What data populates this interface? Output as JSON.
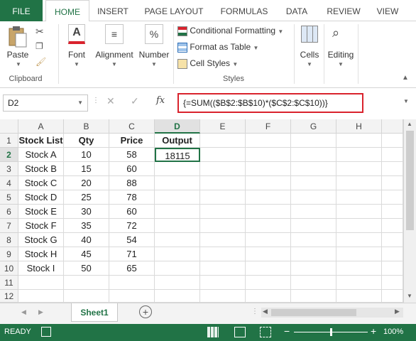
{
  "ribbon": {
    "tabs": [
      "FILE",
      "HOME",
      "INSERT",
      "PAGE LAYOUT",
      "FORMULAS",
      "DATA",
      "REVIEW",
      "VIEW"
    ],
    "active_tab": "HOME",
    "clipboard": {
      "paste": "Paste",
      "group": "Clipboard"
    },
    "font": "Font",
    "alignment": "Alignment",
    "number": "Number",
    "styles": {
      "conditional": "Conditional Formatting",
      "format_table": "Format as Table",
      "cell_styles": "Cell Styles",
      "group": "Styles"
    },
    "cells": "Cells",
    "editing": "Editing"
  },
  "formula_bar": {
    "name_box": "D2",
    "fx": "fx",
    "formula": "{=SUM(($B$2:$B$10)*($C$2:$C$10))}"
  },
  "sheet": {
    "columns": [
      "A",
      "B",
      "C",
      "D",
      "E",
      "F",
      "G",
      "H"
    ],
    "rows": [
      "1",
      "2",
      "3",
      "4",
      "5",
      "6",
      "7",
      "8",
      "9",
      "10",
      "11",
      "12"
    ],
    "headers": [
      "Stock List",
      "Qty",
      "Price",
      "Output"
    ],
    "data": [
      [
        "Stock A",
        "10",
        "58",
        "18115"
      ],
      [
        "Stock B",
        "15",
        "60",
        ""
      ],
      [
        "Stock C",
        "20",
        "88",
        ""
      ],
      [
        "Stock D",
        "25",
        "78",
        ""
      ],
      [
        "Stock E",
        "30",
        "60",
        ""
      ],
      [
        "Stock F",
        "35",
        "72",
        ""
      ],
      [
        "Stock G",
        "40",
        "54",
        ""
      ],
      [
        "Stock H",
        "45",
        "71",
        ""
      ],
      [
        "Stock I",
        "50",
        "65",
        ""
      ]
    ],
    "tab_name": "Sheet1"
  },
  "status": {
    "ready": "READY",
    "zoom": "100%",
    "zoom_level": 1.0
  },
  "colors": {
    "accent": "#217346",
    "highlight": "#d9232d"
  }
}
